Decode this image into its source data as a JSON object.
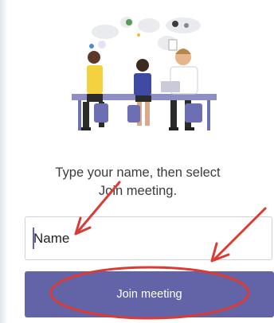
{
  "prompt": {
    "line1": "Type your name, then select",
    "line2": "Join meeting."
  },
  "name_field": {
    "placeholder": "Name",
    "value": ""
  },
  "join_button": {
    "label": "Join meeting",
    "color": "#6264a7"
  },
  "annotation_color": "#d93b35",
  "icons": [
    "meeting-illustration-icon"
  ]
}
